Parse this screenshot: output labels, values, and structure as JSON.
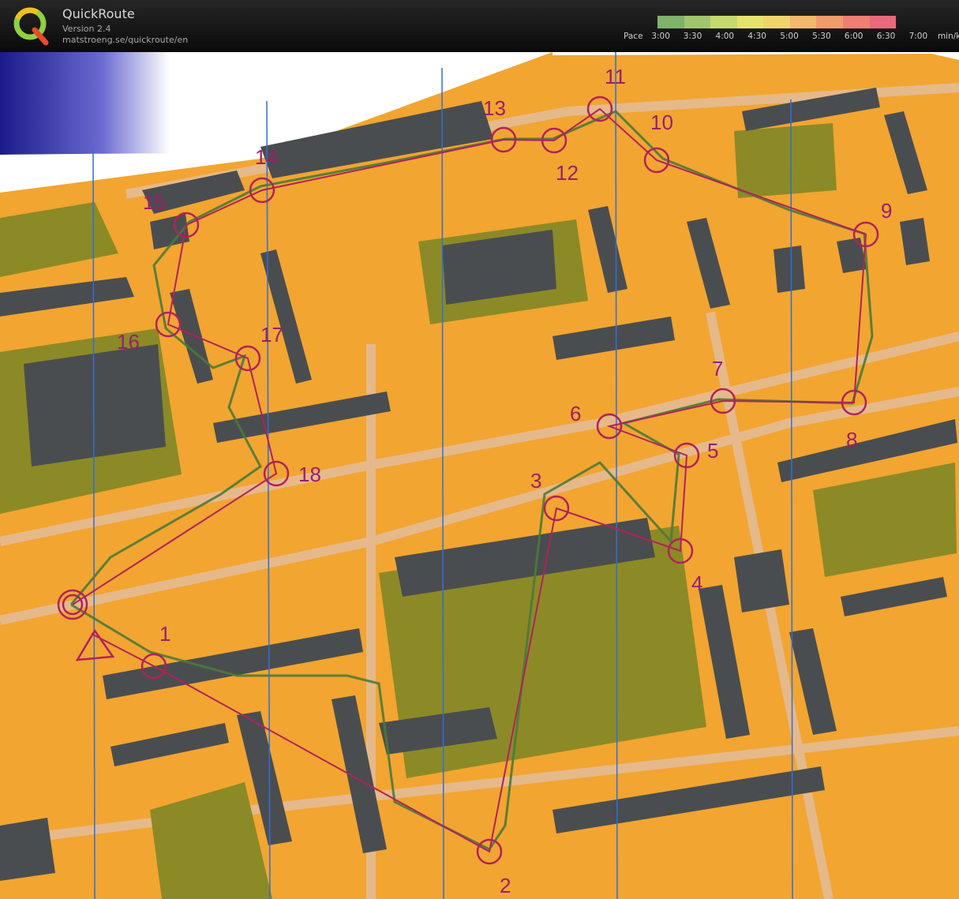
{
  "app": {
    "title": "QuickRoute",
    "version": "Version 2.4",
    "url": "matstroeng.se/quickroute/en"
  },
  "pace_legend": {
    "prefix": "Pace",
    "ticks": [
      "3:00",
      "3:30",
      "4:00",
      "4:30",
      "5:00",
      "5:30",
      "6:00",
      "6:30",
      "7:00"
    ],
    "unit": "min/km",
    "colors": [
      "#7fb26a",
      "#9fc66e",
      "#c6d96d",
      "#e6e36d",
      "#f0d36c",
      "#f2b86b",
      "#f29c6d",
      "#ef7f72",
      "#e86a7a"
    ]
  },
  "map": {
    "colors": {
      "open_land": "#f2a531",
      "rough_open": "#f7c15a",
      "building": "#4a4d4f",
      "green_area": "#8c8a26",
      "paved": "#e6b98a",
      "course": "#b0225c",
      "route": "#4a7a3a",
      "magnetic_north": "#2f6fd6"
    },
    "controls": [
      {
        "label": "1"
      },
      {
        "label": "2"
      },
      {
        "label": "3"
      },
      {
        "label": "4"
      },
      {
        "label": "5"
      },
      {
        "label": "6"
      },
      {
        "label": "7"
      },
      {
        "label": "8"
      },
      {
        "label": "9"
      },
      {
        "label": "10"
      },
      {
        "label": "11"
      },
      {
        "label": "12"
      },
      {
        "label": "13"
      },
      {
        "label": "14"
      },
      {
        "label": "15"
      },
      {
        "label": "16"
      },
      {
        "label": "17"
      },
      {
        "label": "18"
      }
    ]
  }
}
